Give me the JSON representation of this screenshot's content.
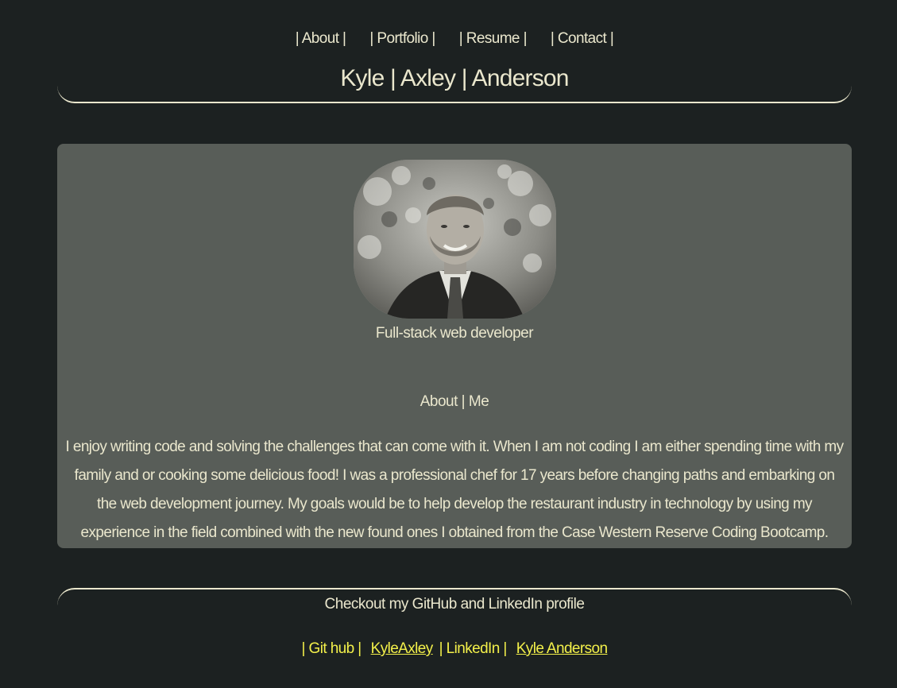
{
  "nav": {
    "about": "| About |",
    "portfolio": "| Portfolio |",
    "resume": "| Resume |",
    "contact": "| Contact |"
  },
  "site_title": "Kyle | Axley | Anderson",
  "profile": {
    "role": "Full-stack web developer"
  },
  "about": {
    "heading": "About | Me",
    "body": "I enjoy writing code and solving the challenges that can come with it. When I am not coding I am either spending time with my family and or cooking some delicious food! I was a professional chef for 17 years before changing paths and embarking on the web development journey. My goals would be to help develop the restaurant industry in technology by using my experience in the field combined with the new found ones I obtained from the Case Western Reserve Coding Bootcamp."
  },
  "footer": {
    "heading": "Checkout my GitHub and LinkedIn profile",
    "github_label": "| Git hub |",
    "github_link": "KyleAxley",
    "linkedin_label": "| LinkedIn |",
    "linkedin_link": "Kyle Anderson"
  },
  "colors": {
    "background": "#1c2121",
    "card": "#585d58",
    "text": "#eae7cd",
    "link": "#f3f04a"
  }
}
